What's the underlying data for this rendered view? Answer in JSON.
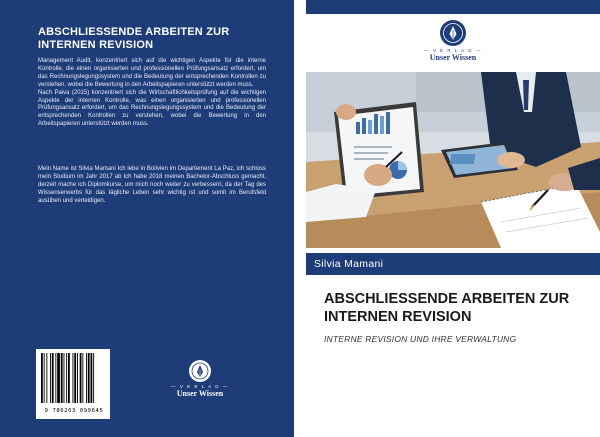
{
  "back": {
    "title": "ABSCHLIESSENDE ARBEITEN ZUR INTERNEN REVISION",
    "description_1": "Management Audit, konzentriert sich auf die wichtigen Aspekte für die interne Kontrolle, die einen organisierten und professionellen Prüfungsansatz erfordert, um das Rechnungslegungssystem und die Bedeutung der entsprechenden Kontrollen zu verstehen, wobei die Bewertung in den Arbeitspapieren unterstützt werden muss.",
    "description_2": "Nach Paiva (2015) konzentriert sich die Wirtschaftlichkeitsprüfung auf die wichtigen Aspekte der internen Kontrolle, was einen organisierten und professionellen Prüfungsansatz erfordert, um das Rechnungslegungssystem und die Bedeutung der entsprechenden Kontrollen zu verstehen, wobei die Bewertung in den Arbeitspapieren unterstützt werden muss.",
    "bio": "Mein Name ist Silvia Mamani Ich lebe in Bolivien im Departement La Paz, ich schloss mein Studium im Jahr 2017 ab Ich habe 2018 meinen Bachelor-Abschluss gemacht, derzeit mache ich Diplomkurse, um mich noch weiter zu verbessern, da der Tag des Wissenserwerbs für das tägliche Leben sehr wichtig ist und somit im Berufsfeld ausüben und verteidigen.",
    "barcode_number": "9 786203 099645"
  },
  "publisher": {
    "verlag": "— V E R L A G —",
    "name": "Unser Wissen"
  },
  "front": {
    "author": "Silvia Mamani",
    "title": "ABSCHLIESSENDE ARBEITEN ZUR INTERNEN REVISION",
    "subtitle": "INTERNE REVISION UND IHRE VERWALTUNG"
  },
  "colors": {
    "cover_blue": "#1d3c78",
    "white": "#ffffff"
  },
  "icons": {
    "publisher_logo": "pen-nib-in-circle-icon"
  }
}
